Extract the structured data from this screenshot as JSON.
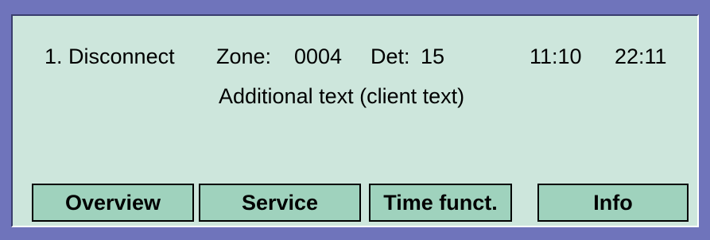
{
  "display": {
    "status_line": {
      "event": "1. Disconnect",
      "zone_label": "Zone:",
      "zone_value": "0004",
      "det_label": "Det:",
      "det_value": "15",
      "time_1": "11:10",
      "time_2": "22:11"
    },
    "additional_text": "Additional text (client text)"
  },
  "softkeys": {
    "overview": "Overview",
    "service": "Service",
    "time_funct": "Time funct.",
    "info": "Info"
  },
  "colors": {
    "frame": "#6f74bb",
    "screen": "#cde6dc",
    "button": "#9fd2bd"
  }
}
